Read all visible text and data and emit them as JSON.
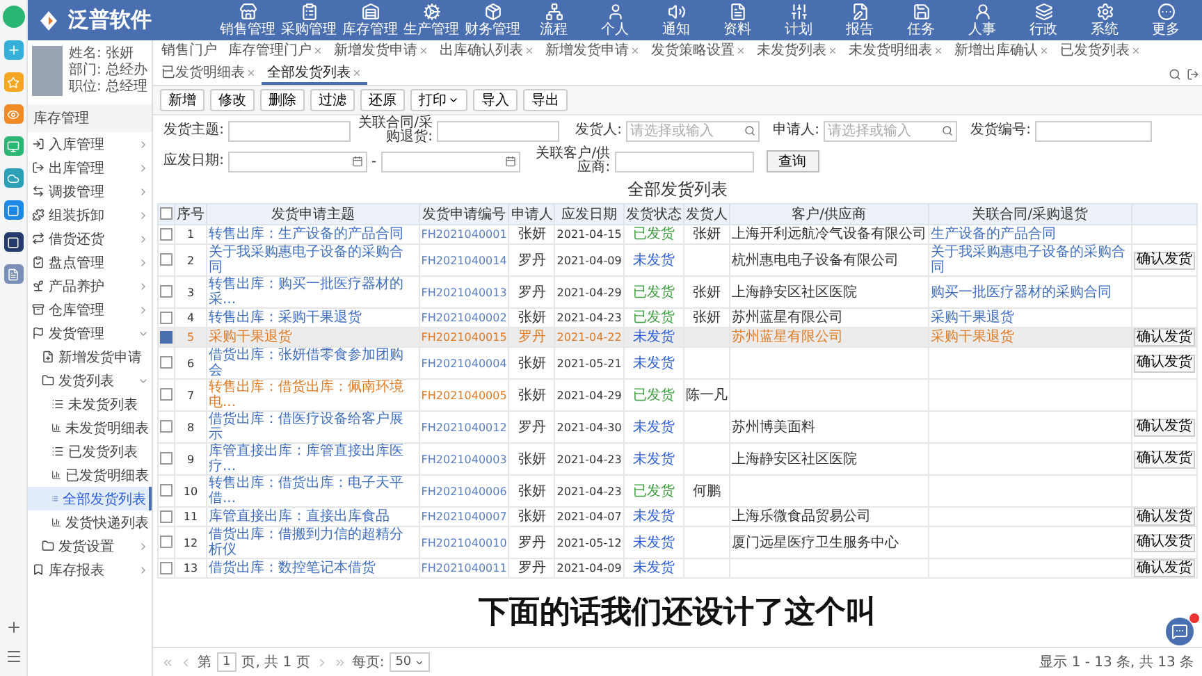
{
  "app": {
    "name": "泛普软件"
  },
  "modules": [
    {
      "label": "销售管理"
    },
    {
      "label": "采购管理"
    },
    {
      "label": "库存管理"
    },
    {
      "label": "生产管理"
    },
    {
      "label": "财务管理"
    },
    {
      "label": "流程"
    },
    {
      "label": "个人"
    },
    {
      "label": "通知"
    },
    {
      "label": "资料"
    },
    {
      "label": "计划"
    },
    {
      "label": "报告"
    },
    {
      "label": "任务"
    },
    {
      "label": "人事"
    },
    {
      "label": "行政"
    },
    {
      "label": "系统"
    },
    {
      "label": "更多"
    }
  ],
  "profile": {
    "name": "姓名: 张妍",
    "department": "部门: 总经办",
    "position": "职位: 总经理"
  },
  "sidebar": {
    "title": "库存管理",
    "items": [
      {
        "label": "入库管理",
        "expanded": false,
        "selected": false
      },
      {
        "label": "出库管理",
        "expanded": false,
        "selected": false
      },
      {
        "label": "调拨管理",
        "expanded": false,
        "selected": false
      },
      {
        "label": "组装拆卸",
        "expanded": false,
        "selected": false
      },
      {
        "label": "借货还货",
        "expanded": false,
        "selected": false
      },
      {
        "label": "盘点管理",
        "expanded": false,
        "selected": false
      },
      {
        "label": "产品养护",
        "expanded": false,
        "selected": false
      },
      {
        "label": "仓库管理",
        "expanded": false,
        "selected": false
      },
      {
        "label": "发货管理",
        "expanded": true,
        "selected": false,
        "children": [
          {
            "label": "新增发货申请",
            "selected": false
          },
          {
            "label": "发货列表",
            "expanded": true,
            "selected": false,
            "children": [
              {
                "label": "未发货列表",
                "selected": false
              },
              {
                "label": "未发货明细表",
                "selected": false
              },
              {
                "label": "已发货列表",
                "selected": false
              },
              {
                "label": "已发货明细表",
                "selected": false
              },
              {
                "label": "全部发货列表",
                "selected": true
              },
              {
                "label": "发货快递列表",
                "selected": false
              }
            ]
          },
          {
            "label": "发货设置",
            "expanded": false,
            "selected": false
          }
        ]
      },
      {
        "label": "库存报表",
        "expanded": false,
        "selected": false
      }
    ]
  },
  "tabs": [
    {
      "label": "销售门户",
      "closable": false,
      "selected": false
    },
    {
      "label": "库存管理门户",
      "closable": true,
      "selected": false
    },
    {
      "label": "新增发货申请",
      "closable": true,
      "selected": false
    },
    {
      "label": "出库确认列表",
      "closable": true,
      "selected": false
    },
    {
      "label": "新增发货申请",
      "closable": true,
      "selected": false
    },
    {
      "label": "发货策略设置",
      "closable": true,
      "selected": false
    },
    {
      "label": "未发货列表",
      "closable": true,
      "selected": false
    },
    {
      "label": "未发货明细表",
      "closable": true,
      "selected": false
    },
    {
      "label": "新增出库确认",
      "closable": true,
      "selected": false
    },
    {
      "label": "已发货列表",
      "closable": true,
      "selected": false
    },
    {
      "label": "已发货明细表",
      "closable": true,
      "selected": false
    },
    {
      "label": "全部发货列表",
      "closable": true,
      "selected": true
    }
  ],
  "toolbar": [
    {
      "label": "新增",
      "dropdown": false
    },
    {
      "label": "修改",
      "dropdown": false
    },
    {
      "label": "删除",
      "dropdown": false
    },
    {
      "label": "过滤",
      "dropdown": false
    },
    {
      "label": "还原",
      "dropdown": false
    },
    {
      "label": "打印",
      "dropdown": true
    },
    {
      "label": "导入",
      "dropdown": false
    },
    {
      "label": "导出",
      "dropdown": false
    }
  ],
  "filters": {
    "subject": {
      "label": "发货主题:"
    },
    "contract": {
      "label": "关联合同/采购退货:"
    },
    "shipper": {
      "label": "发货人:",
      "placeholder": "请选择或输入"
    },
    "applicant": {
      "label": "申请人:",
      "placeholder": "请选择或输入"
    },
    "number": {
      "label": "发货编号:"
    },
    "due_date": {
      "label": "应发日期:",
      "separator": "-"
    },
    "customer": {
      "label": "关联客户/供应商:"
    },
    "search_button": "查询"
  },
  "table": {
    "title": "全部发货列表",
    "all_checked": false,
    "columns": [
      "序号",
      "发货申请主题",
      "发货申请编号",
      "申请人",
      "应发日期",
      "发货状态",
      "发货人",
      "客户/供应商",
      "关联合同/采购退货"
    ],
    "rows": [
      {
        "index": "1",
        "subject": "转售出库：生产设备的产品合同",
        "code": "FH2021040001",
        "applicant": "张妍",
        "due_date": "2021-04-15",
        "status": "已发货",
        "shipped": true,
        "shipper": "张妍",
        "customer": "上海开利远航冷气设备有限公司",
        "contract": "生产设备的产品合同",
        "selected": false,
        "flagged": false
      },
      {
        "index": "2",
        "subject": "关于我采购惠电子设备的采购合同",
        "code": "FH2021040014",
        "applicant": "罗丹",
        "due_date": "2021-04-09",
        "status": "未发货",
        "shipped": false,
        "customer": "杭州惠电电子设备有限公司",
        "contract": "关于我采购惠电子设备的采购合同",
        "action": "确认发货",
        "selected": false,
        "flagged": false
      },
      {
        "index": "3",
        "subject": "转售出库：购买一批医疗器材的采...",
        "code": "FH2021040013",
        "applicant": "罗丹",
        "due_date": "2021-04-29",
        "status": "已发货",
        "shipped": true,
        "shipper": "张妍",
        "customer": "上海静安区社区医院",
        "contract": "购买一批医疗器材的采购合同",
        "selected": false,
        "flagged": false
      },
      {
        "index": "4",
        "subject": "转售出库：采购干果退货",
        "code": "FH2021040002",
        "applicant": "张妍",
        "due_date": "2021-04-23",
        "status": "已发货",
        "shipped": true,
        "shipper": "张妍",
        "customer": "苏州蓝星有限公司",
        "contract": "采购干果退货",
        "selected": false,
        "flagged": false
      },
      {
        "index": "5",
        "subject": "采购干果退货",
        "code": "FH2021040015",
        "applicant": "罗丹",
        "due_date": "2021-04-22",
        "status": "未发货",
        "shipped": false,
        "customer": "苏州蓝星有限公司",
        "contract": "采购干果退货",
        "action": "确认发货",
        "selected": true
      },
      {
        "index": "6",
        "subject": "借货出库：张妍借零食参加团购会",
        "code": "FH2021040004",
        "applicant": "张妍",
        "due_date": "2021-05-21",
        "status": "未发货",
        "shipped": false,
        "action": "确认发货",
        "selected": false,
        "flagged": false
      },
      {
        "index": "7",
        "subject": "转售出库：借货出库：佩南环境电...",
        "code": "FH2021040005",
        "applicant": "张妍",
        "due_date": "2021-04-29",
        "status": "已发货",
        "shipped": true,
        "shipper": "陈一凡",
        "selected": false,
        "flagged": true
      },
      {
        "index": "8",
        "subject": "借货出库：借医疗设备给客户展示",
        "code": "FH2021040012",
        "applicant": "罗丹",
        "due_date": "2021-04-30",
        "status": "未发货",
        "shipped": false,
        "customer": "苏州博美面料",
        "action": "确认发货",
        "selected": false,
        "flagged": false
      },
      {
        "index": "9",
        "subject": "库管直接出库：库管直接出库医疗...",
        "code": "FH2021040003",
        "applicant": "张妍",
        "due_date": "2021-04-23",
        "status": "未发货",
        "shipped": false,
        "customer": "上海静安区社区医院",
        "action": "确认发货",
        "selected": false,
        "flagged": false
      },
      {
        "index": "10",
        "subject": "转售出库：借货出库：电子天平借...",
        "code": "FH2021040006",
        "applicant": "张妍",
        "due_date": "2021-04-23",
        "status": "已发货",
        "shipped": true,
        "shipper": "何鹏",
        "selected": false,
        "flagged": false
      },
      {
        "index": "11",
        "subject": "库管直接出库：直接出库食品",
        "code": "FH2021040007",
        "applicant": "张妍",
        "due_date": "2021-04-07",
        "status": "未发货",
        "shipped": false,
        "customer": "上海乐微食品贸易公司",
        "action": "确认发货",
        "selected": false,
        "flagged": false
      },
      {
        "index": "12",
        "subject": "借货出库：借搬到力信的超精分析仪",
        "code": "FH2021040010",
        "applicant": "罗丹",
        "due_date": "2021-05-12",
        "status": "未发货",
        "shipped": false,
        "customer": "厦门远星医疗卫生服务中心",
        "action": "确认发货",
        "selected": false,
        "flagged": false
      },
      {
        "index": "13",
        "subject": "借货出库：数控笔记本借货",
        "code": "FH2021040011",
        "applicant": "罗丹",
        "due_date": "2021-04-09",
        "status": "未发货",
        "shipped": false,
        "action": "确认发货",
        "selected": false,
        "flagged": false
      }
    ]
  },
  "caption": "下面的话我们还设计了这个叫",
  "pager": {
    "page_prefix": "第",
    "page": "1",
    "page_suffix": "页, 共 1 页",
    "per_page_label": "每页:",
    "per_page": "50",
    "summary": "显示 1 - 13 条, 共 13 条"
  }
}
